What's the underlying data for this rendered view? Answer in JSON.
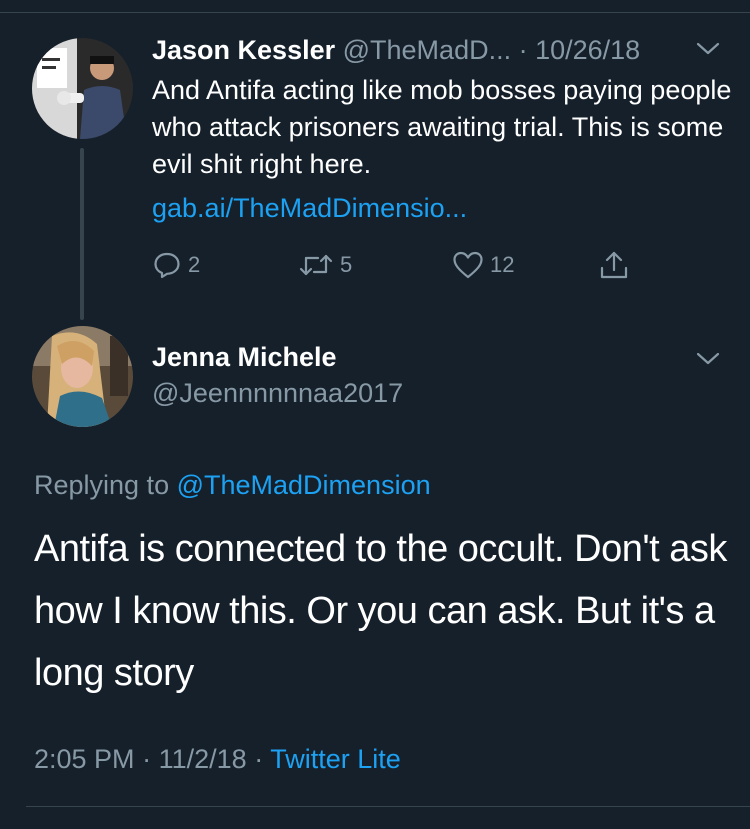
{
  "parent_tweet": {
    "author_name": "Jason Kessler",
    "author_handle": "@TheMadD...",
    "separator": " · ",
    "date": "10/26/18",
    "text": "And Antifa acting like mob bosses paying people who attack prisoners awaiting trial. This is some evil shit right here.",
    "link": "gab.ai/TheMadDimensio...",
    "reply_count": "2",
    "retweet_count": "5",
    "like_count": "12",
    "icons": {
      "reply": "reply-icon",
      "retweet": "retweet-icon",
      "like": "heart-icon",
      "share": "share-icon",
      "menu": "chevron-down-icon"
    }
  },
  "reply_tweet": {
    "author_name": "Jenna Michele",
    "author_handle": "@Jeennnnnnaa2017",
    "replying_prefix": "Replying to ",
    "replying_to": "@TheMadDimension",
    "text": "Antifa is connected to the occult. Don't ask how I know this. Or you can ask. But it's a long story",
    "time": "2:05 PM",
    "date": "11/2/18",
    "source": "Twitter Lite"
  },
  "colors": {
    "background": "#15202b",
    "primary_text": "#ffffff",
    "secondary_text": "#8899a6",
    "accent": "#1da1f2",
    "divider": "#38444d"
  }
}
